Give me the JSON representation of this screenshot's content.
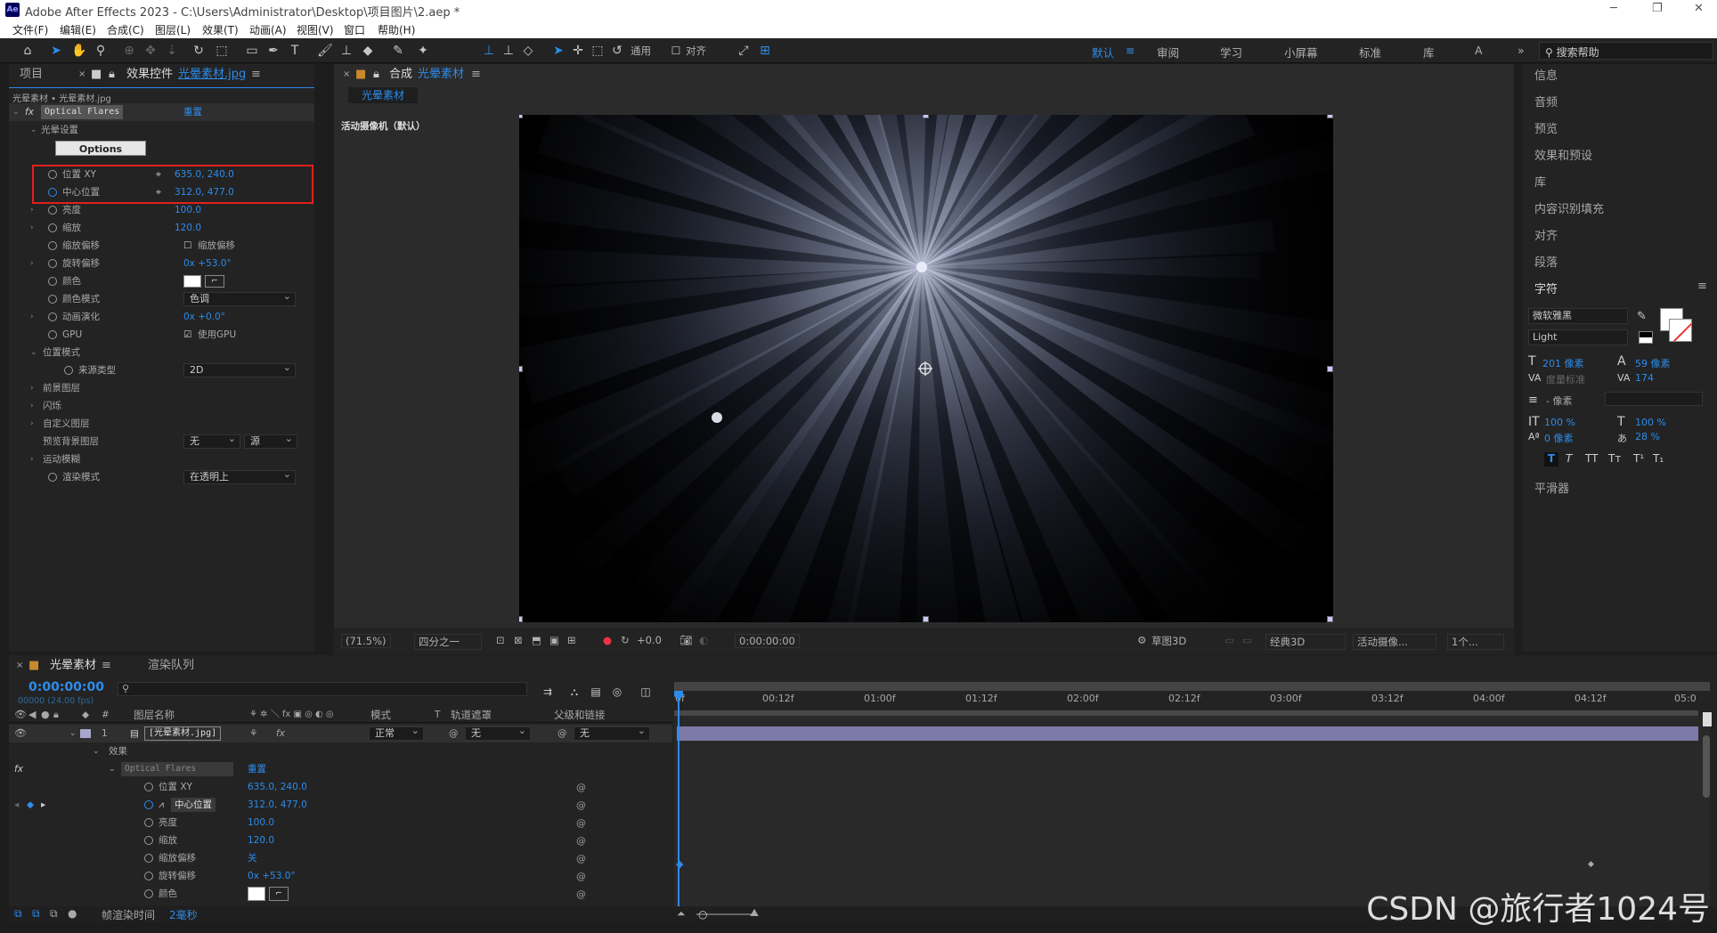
{
  "window": {
    "title": "Adobe After Effects 2023 - C:\\Users\\Administrator\\Desktop\\项目图片\\2.aep *",
    "app_icon": "Ae"
  },
  "menu": [
    "文件(F)",
    "编辑(E)",
    "合成(C)",
    "图层(L)",
    "效果(T)",
    "动画(A)",
    "视图(V)",
    "窗口",
    "帮助(H)"
  ],
  "toolbar": {
    "snap_label": "通用",
    "align_label": "对齐"
  },
  "workspaces": [
    "默认",
    "审阅",
    "学习",
    "小屏幕",
    "标准",
    "库",
    "A"
  ],
  "workspace_active": "默认",
  "help_search": "搜索帮助",
  "effect_panel": {
    "tab_project": "项目",
    "tab_effects": "效果控件",
    "tab_effects_file": "光晕素材.jpg",
    "breadcrumb": "光晕素材 • 光晕素材.jpg",
    "effect_name": "Optical Flares",
    "reset_label": "重置",
    "group_flare": "光晕设置",
    "options_button": "Options",
    "rows": [
      {
        "label": "位置 XY",
        "value": "635.0, 240.0"
      },
      {
        "label": "中心位置",
        "value": "312.0, 477.0"
      },
      {
        "label": "亮度",
        "value": "100.0"
      },
      {
        "label": "缩放",
        "value": "120.0"
      },
      {
        "label": "缩放偏移",
        "value": "缩放偏移"
      },
      {
        "label": "旋转偏移",
        "value": "0x +53.0°"
      },
      {
        "label": "颜色",
        "value": ""
      },
      {
        "label": "颜色模式",
        "value": "色调"
      },
      {
        "label": "动画演化",
        "value": "0x +0.0°"
      },
      {
        "label": "GPU",
        "value": "使用GPU"
      }
    ],
    "group_position_mode": "位置模式",
    "source_type_label": "来源类型",
    "source_type_value": "2D",
    "groups": [
      "前景图层",
      "闪烁",
      "自定义图层"
    ],
    "preview_bg_label": "预览背景图层",
    "preview_bg_value1": "无",
    "preview_bg_value2": "源",
    "motion_blur": "运动模糊",
    "render_mode_label": "渲染模式",
    "render_mode_value": "在透明上"
  },
  "comp_panel": {
    "tab_label": "合成",
    "comp_name": "光晕素材",
    "sub_tab": "光晕素材",
    "camera_label": "活动摄像机（默认）",
    "zoom": "(71.5%)",
    "resolution": "四分之一",
    "exposure": "+0.0",
    "timecode": "0:00:00:00",
    "draft3d": "草图3D",
    "renderer": "经典3D",
    "camera_view": "活动摄像...",
    "views": "1个..."
  },
  "right_panel": {
    "items": [
      "信息",
      "音频",
      "预览",
      "效果和预设",
      "库",
      "内容识别填充",
      "对齐",
      "段落"
    ],
    "character": "字符",
    "font": "微软雅黑",
    "weight": "Light",
    "font_size": "201 像素",
    "leading": "59 像素",
    "kerning": "度量标准",
    "tracking": "174",
    "stroke": "- 像素",
    "vscale": "100 %",
    "hscale": "100 %",
    "baseline": "0 像素",
    "tsume": "28 %",
    "styles": [
      "T",
      "T",
      "TT",
      "Tт",
      "T¹",
      "T₁"
    ],
    "smoother": "平滑器"
  },
  "timeline": {
    "tab": "光晕素材",
    "render_queue": "渲染队列",
    "time": "0:00:00:00",
    "fps": "00000 (24.00 fps)",
    "col_layer_name": "图层名称",
    "col_mode": "模式",
    "col_track": "轨道遮罩",
    "col_parent": "父级和链接",
    "layer_num": "1",
    "layer_name": "[光晕素材.jpg]",
    "mode": "正常",
    "track": "无",
    "parent": "无",
    "effects_label": "效果",
    "effect_name": "Optical Flares",
    "reset": "重置",
    "rows": [
      {
        "label": "位置 XY",
        "value": "635.0, 240.0"
      },
      {
        "label": "中心位置",
        "value": "312.0, 477.0"
      },
      {
        "label": "亮度",
        "value": "100.0"
      },
      {
        "label": "缩放",
        "value": "120.0"
      },
      {
        "label": "缩放偏移",
        "value": "关"
      },
      {
        "label": "旋转偏移",
        "value": "0x +53.0°"
      },
      {
        "label": "颜色",
        "value": ""
      }
    ],
    "ruler": [
      "0f",
      "00:12f",
      "01:00f",
      "01:12f",
      "02:00f",
      "02:12f",
      "03:00f",
      "03:12f",
      "04:00f",
      "04:12f",
      "05:0"
    ],
    "frame_render_label": "帧渲染时间",
    "frame_render_value": "2毫秒"
  },
  "watermark": "CSDN @旅行者1024号"
}
